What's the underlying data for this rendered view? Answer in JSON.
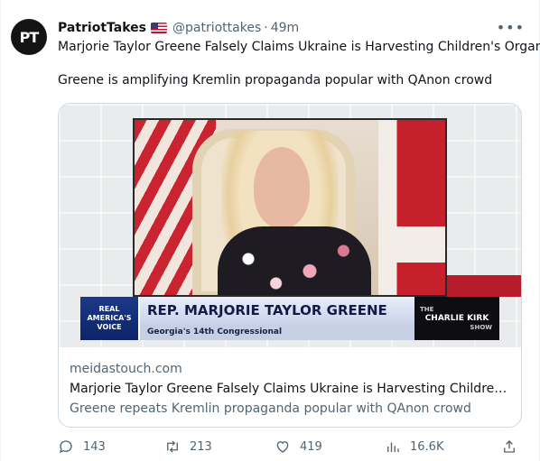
{
  "author": {
    "display_name": "PatriotTakes",
    "avatar_text": "PT",
    "flag_icon": "us-flag-icon",
    "handle": "@patriottakes",
    "separator": "·",
    "time": "49m"
  },
  "more_label": "•••",
  "tweet": {
    "line1": "Marjorie Taylor Greene Falsely Claims Ukraine is Harvesting Children's Organs",
    "line2": "Greene is amplifying Kremlin propaganda popular with QAnon crowd"
  },
  "card": {
    "thumbnail": {
      "network_logo_lines": [
        "REAL",
        "AMERICA'S",
        "VOICE"
      ],
      "chyron_title": "REP. MARJORIE TAYLOR GREENE",
      "chyron_subtitle": "Georgia's 14th Congressional",
      "show_logo_top": "THE",
      "show_logo_name": "CHARLIE KIRK",
      "show_logo_bottom": "SHOW"
    },
    "domain": "meidastouch.com",
    "title": "Marjorie Taylor Greene Falsely Claims Ukraine is Harvesting Children's Or...",
    "description": "Greene repeats Kremlin propaganda popular with QAnon crowd"
  },
  "actions": {
    "replies": "143",
    "retweets": "213",
    "likes": "419",
    "views": "16.6K"
  },
  "colors": {
    "text_primary": "#0f1419",
    "text_secondary": "#536471",
    "border": "#cfd9de"
  }
}
